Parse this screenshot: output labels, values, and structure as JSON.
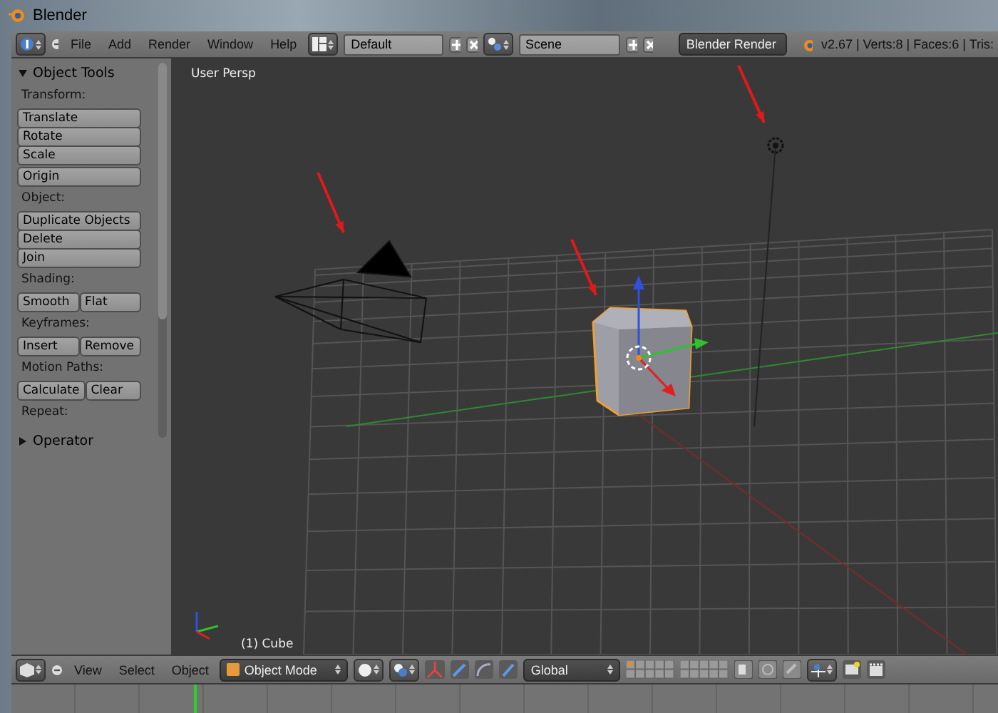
{
  "window": {
    "title": "Blender"
  },
  "info_header": {
    "menus": [
      "File",
      "Add",
      "Render",
      "Window",
      "Help"
    ],
    "layout": "Default",
    "scene": "Scene",
    "engine": "Blender Render",
    "stats": "v2.67 | Verts:8 | Faces:6 | Tris:"
  },
  "tool_panels": [
    {
      "title": "Object Tools",
      "expanded": true,
      "sections": [
        {
          "label": "Transform:",
          "rows": [
            [
              "Translate"
            ],
            [
              "Rotate"
            ],
            [
              "Scale"
            ]
          ]
        },
        {
          "rows": [
            [
              "Origin"
            ]
          ]
        },
        {
          "label": "Object:",
          "rows": [
            [
              "Duplicate Objects"
            ],
            [
              "Delete"
            ],
            [
              "Join"
            ]
          ]
        },
        {
          "label": "Shading:",
          "rows": [
            [
              "Smooth",
              "Flat"
            ]
          ]
        },
        {
          "label": "Keyframes:",
          "rows": [
            [
              "Insert",
              "Remove"
            ]
          ]
        },
        {
          "label": "Motion Paths:",
          "rows": [
            [
              "Calculate",
              "Clear"
            ]
          ]
        },
        {
          "label": "Repeat:"
        }
      ]
    },
    {
      "title": "Operator",
      "expanded": false
    }
  ],
  "viewport": {
    "view_name": "User Persp",
    "object_name": "(1) Cube"
  },
  "view3d_header": {
    "menus": [
      "View",
      "Select",
      "Object"
    ],
    "mode": "Object Mode",
    "orientation": "Global"
  }
}
